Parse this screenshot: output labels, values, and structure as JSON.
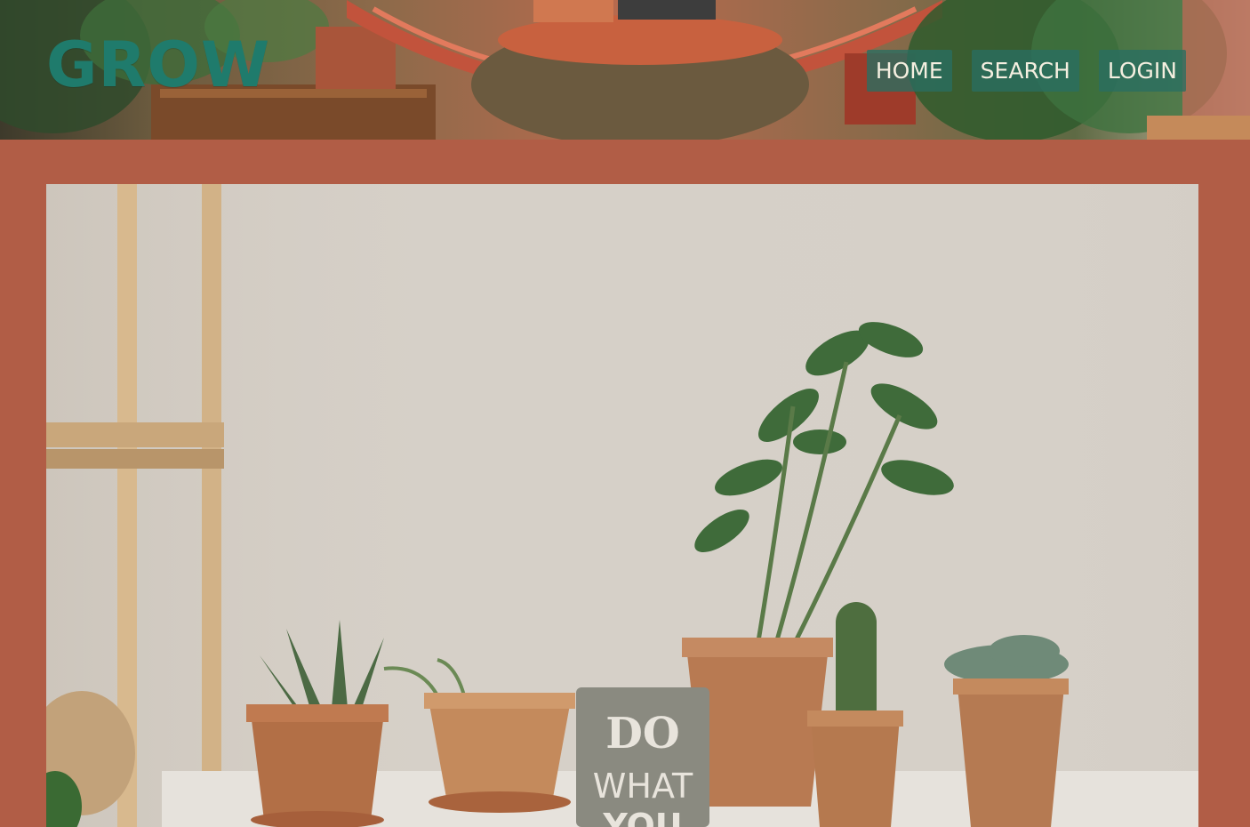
{
  "brand": {
    "logo_text": "GROW"
  },
  "nav": {
    "items": [
      {
        "label": "HOME"
      },
      {
        "label": "SEARCH"
      },
      {
        "label": "LOGIN"
      }
    ]
  },
  "hero": {
    "sign_lines": [
      "DO",
      "WHAT",
      "YOU"
    ]
  },
  "colors": {
    "page_background": "#b15d46",
    "logo": "#1f7b6c",
    "nav_button": "#296e61",
    "nav_text": "#f5efe0",
    "wall": "#d4cec6",
    "terracotta": "#b87a52",
    "leaf": "#3f6b3a"
  }
}
